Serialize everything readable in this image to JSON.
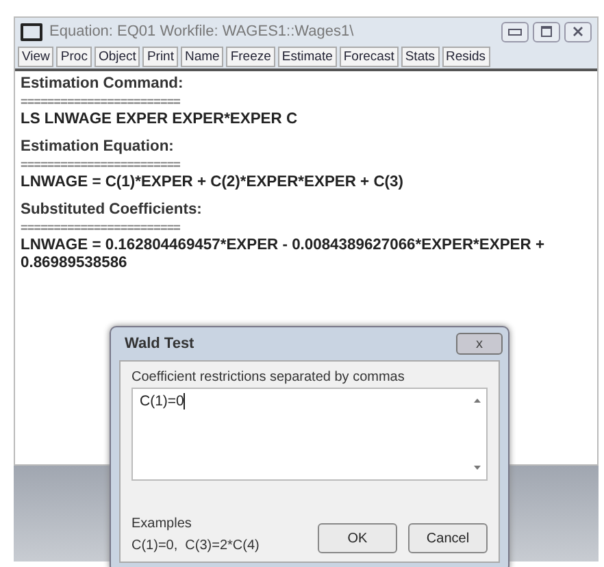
{
  "window": {
    "title": "Equation: EQ01   Workfile: WAGES1::Wages1\\"
  },
  "toolbar": [
    {
      "label": "View"
    },
    {
      "label": "Proc"
    },
    {
      "label": "Object"
    },
    {
      "label": "Print"
    },
    {
      "label": "Name"
    },
    {
      "label": "Freeze"
    },
    {
      "label": "Estimate"
    },
    {
      "label": "Forecast"
    },
    {
      "label": "Stats"
    },
    {
      "label": "Resids"
    }
  ],
  "output": [
    {
      "kind": "heading",
      "text": "Estimation Command:"
    },
    {
      "kind": "rule",
      "text": "========================"
    },
    {
      "kind": "line",
      "text": "LS LNWAGE EXPER EXPER*EXPER C"
    },
    {
      "kind": "heading",
      "text": "Estimation Equation:"
    },
    {
      "kind": "rule",
      "text": "========================"
    },
    {
      "kind": "line",
      "text": "LNWAGE = C(1)*EXPER + C(2)*EXPER*EXPER + C(3)"
    },
    {
      "kind": "heading",
      "text": "Substituted Coefficients:"
    },
    {
      "kind": "rule",
      "text": "========================"
    },
    {
      "kind": "line",
      "text": "LNWAGE = 0.162804469457*EXPER - 0.0084389627066*EXPER*EXPER +"
    },
    {
      "kind": "cont",
      "text": "0.86989538586"
    }
  ],
  "dialog": {
    "title": "Wald Test",
    "close": "x",
    "group_label": "Coefficient restrictions separated by commas",
    "value": "C(1)=0",
    "examples_label": "Examples",
    "examples": "C(1)=0,  C(3)=2*C(4)",
    "buttons": [
      "OK",
      "Cancel"
    ]
  }
}
